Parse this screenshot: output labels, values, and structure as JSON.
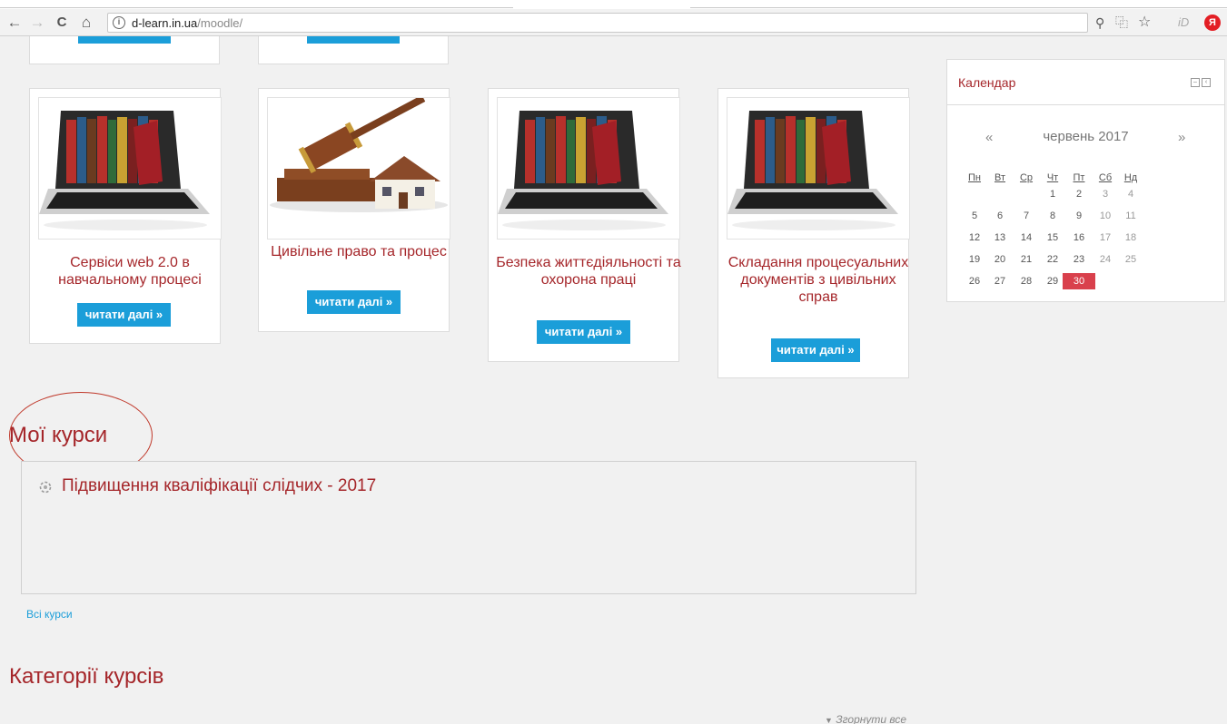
{
  "browser": {
    "url_host": "d-learn.in.ua",
    "url_path": "/moodle/",
    "info_symbol": "i",
    "back": "←",
    "forward": "→",
    "reload": "C",
    "home": "⌂",
    "key_icon": "⚲",
    "translate_icon": "⿻",
    "star_icon": "☆",
    "id_icon": "iD",
    "ya_icon": "Я"
  },
  "courses": [
    {
      "title": "Сервіси web 2.0 в навчальному процесі",
      "button": "читати далі »",
      "image": "laptop-books-icon"
    },
    {
      "title": "Цивільне право та процес",
      "button": "читати далі »",
      "image": "gavel-house-icon"
    },
    {
      "title": "Безпека життєдіяльності та охорона праці",
      "button": "читати далі »",
      "image": "laptop-books-icon"
    },
    {
      "title": "Складання процесуальних документів з цивільних справ",
      "button": "читати далі »",
      "image": "laptop-books-icon"
    }
  ],
  "calendar": {
    "title": "Календар",
    "month": "червень 2017",
    "prev": "«",
    "next": "»",
    "weekdays": [
      "Пн",
      "Вт",
      "Ср",
      "Чт",
      "Пт",
      "Сб",
      "Нд"
    ],
    "weeks": [
      [
        "",
        "",
        "",
        "1",
        "2",
        "3",
        "4"
      ],
      [
        "5",
        "6",
        "7",
        "8",
        "9",
        "10",
        "11"
      ],
      [
        "12",
        "13",
        "14",
        "15",
        "16",
        "17",
        "18"
      ],
      [
        "19",
        "20",
        "21",
        "22",
        "23",
        "24",
        "25"
      ],
      [
        "26",
        "27",
        "28",
        "29",
        "30",
        "",
        ""
      ]
    ],
    "today": "30",
    "today_color": "#d9404c"
  },
  "my_courses": {
    "heading": "Мої курси",
    "items": [
      "Підвищення кваліфікації слідчих - 2017"
    ],
    "all_courses_link": "Всі курси"
  },
  "categories": {
    "heading": "Категорії курсів",
    "collapse_all": "Згорнути все"
  },
  "colors": {
    "accent": "#a5262a",
    "button": "#1b9ed9",
    "background": "#f1f1f1"
  }
}
